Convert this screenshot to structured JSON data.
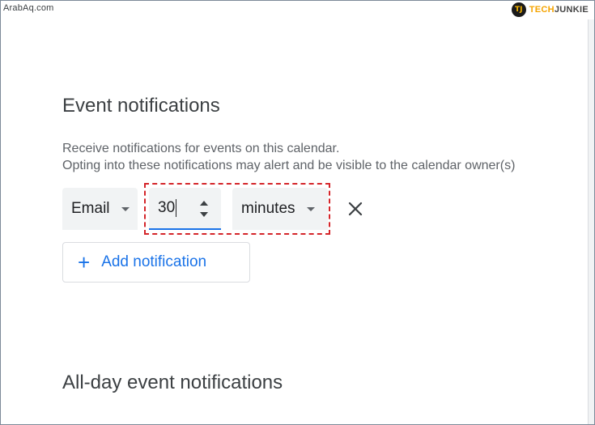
{
  "watermarks": {
    "left": "ArabAq.com",
    "logo_badge": "TJ",
    "logo_tech": "TECH",
    "logo_junkie": "JUNKIE"
  },
  "event_notifications": {
    "title": "Event notifications",
    "description_line1": "Receive notifications for events on this calendar.",
    "description_line2": "Opting into these notifications may alert and be visible to the calendar owner(s)",
    "notification": {
      "method": "Email",
      "amount": "30",
      "unit": "minutes"
    },
    "add_button_plus": "+",
    "add_button_label": "Add notification"
  },
  "all_day": {
    "title": "All-day event notifications"
  },
  "colors": {
    "accent": "#1a73e8",
    "highlight": "#d4252a",
    "field_bg": "#f1f3f4"
  },
  "icons": {
    "remove": "close-icon",
    "method_caret": "caret-down-icon",
    "unit_caret": "caret-down-icon",
    "spinner": "spinner-arrows-icon"
  }
}
